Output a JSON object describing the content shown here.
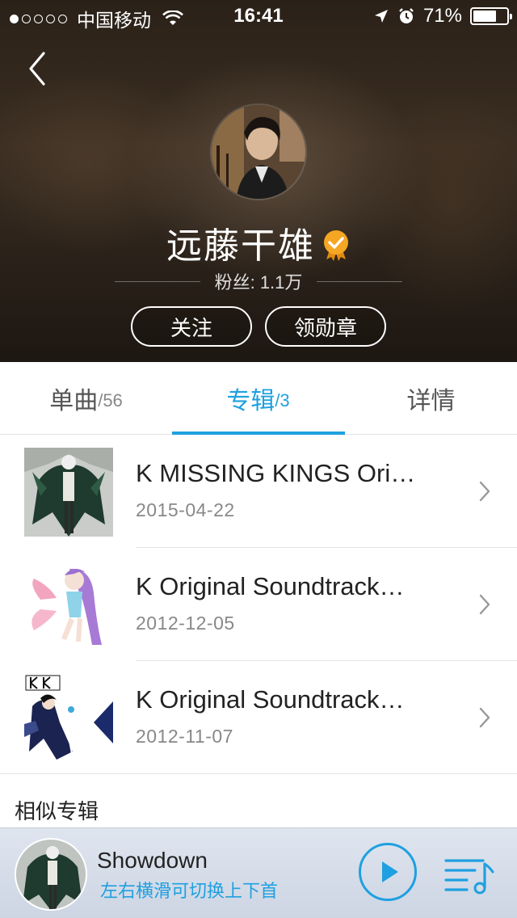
{
  "status_bar": {
    "carrier": "中国移动",
    "time": "16:41",
    "battery": "71%",
    "battery_level": 0.71
  },
  "header": {
    "artist_name": "远藤干雄",
    "fans_label": "粉丝: 1.1万",
    "follow_button": "关注",
    "badge_button": "领勋章"
  },
  "tabs": [
    {
      "label": "单曲",
      "count": "/56"
    },
    {
      "label": "专辑",
      "count": "/3"
    },
    {
      "label": "详情",
      "count": ""
    }
  ],
  "albums": [
    {
      "title": "K MISSING KINGS Ori…",
      "date": "2015-04-22"
    },
    {
      "title": "K Original Soundtrack…",
      "date": "2012-12-05"
    },
    {
      "title": "K Original Soundtrack…",
      "date": "2012-11-07"
    }
  ],
  "similar_section": "相似专辑",
  "player": {
    "title": "Showdown",
    "subtitle": "左右横滑可切换上下首"
  },
  "colors": {
    "accent": "#1fa0e0",
    "verified_badge": "#f5a623"
  }
}
